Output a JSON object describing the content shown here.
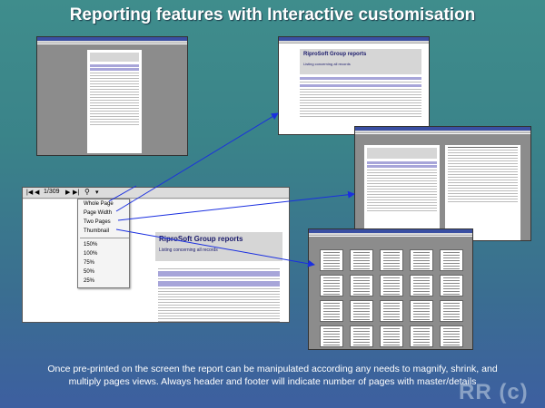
{
  "title": "Reporting features with Interactive customisation",
  "report": {
    "title": "RiproSoft Group reports",
    "subtitle": "Listing concerning all records"
  },
  "toolbar": {
    "page_indicator": "1/309",
    "zoom_icon": "magnifier-icon"
  },
  "zoom_menu": {
    "items": [
      "Whole Page",
      "Page Width",
      "Two Pages",
      "Thumbnail"
    ],
    "percentages": [
      "150%",
      "100%",
      "75%",
      "50%",
      "25%"
    ]
  },
  "caption": {
    "line1": "Once pre-printed on the screen the report can be manipulated according any needs to magnify, shrink, and",
    "line2": "multiply pages views. Always header and footer will indicate number of pages with master/details"
  },
  "watermark": "RR (c)",
  "colors": {
    "arrow": "#1a2fe0",
    "band": "#a7a5d9",
    "title_bar": "#3a4fa2"
  }
}
